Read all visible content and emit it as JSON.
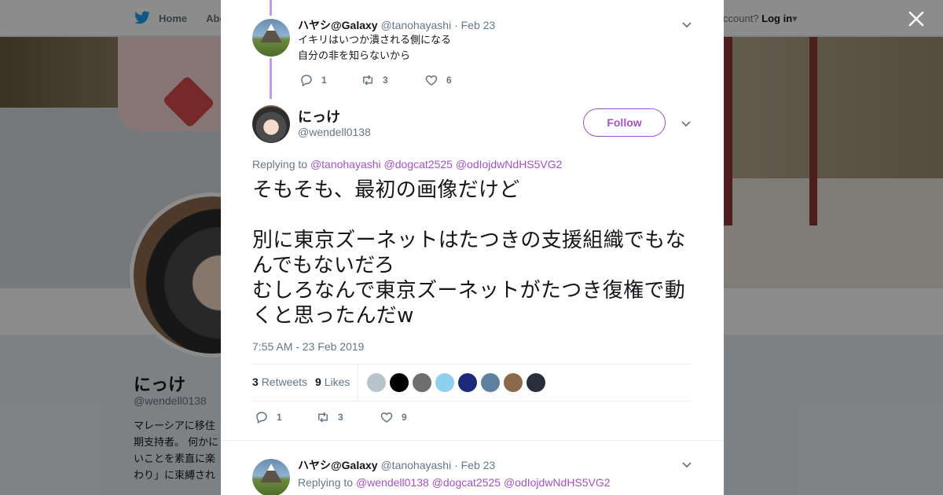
{
  "background": {
    "nav_home": "Home",
    "nav_about": "Abo",
    "account_prompt": "ccount?",
    "login_label": "Log in",
    "profile_name": "にっけ",
    "profile_handle": "@wendell0138",
    "bio": "マレーシアに移住\n期支持者。 何かに\nいことを素直に楽\nわり」に束縛され"
  },
  "colors": {
    "accent": "#a450c8",
    "thread": "#c897e8",
    "muted": "#657786",
    "text": "#14171a"
  },
  "prev_tweet": {
    "name": "ハヤシ@Galaxy",
    "handle": "@tanohayashi",
    "time": "· Feb 23",
    "text": "イキリはいつか潰される側になる\n自分の非を知らないから",
    "replies": "1",
    "retweets": "3",
    "likes": "6"
  },
  "main_tweet": {
    "name": "にっけ",
    "handle": "@wendell0138",
    "follow_label": "Follow",
    "replying_prefix": "Replying to",
    "mentions": [
      "@tanohayashi",
      "@dogcat2525",
      "@odIojdwNdHS5VG2"
    ],
    "text": "そもそも、最初の画像だけど\n\n別に東京ズーネットはたつきの支援組織でもなんでもないだろ\nむしろなんで東京ズーネットがたつき復権で動くと思ったんだw",
    "timestamp": "7:55 AM - 23 Feb 2019",
    "retweets_count": "3",
    "retweets_label": "Retweets",
    "likes_count": "9",
    "likes_label": "Likes",
    "liker_colors": [
      "#b8c4cc",
      "#000000",
      "#6e6e6e",
      "#8fd0f0",
      "#1b2a7a",
      "#5f7f9f",
      "#8a6a4a",
      "#2a2e3a"
    ],
    "replies": "1",
    "retweets": "3",
    "likes": "9"
  },
  "next_tweet": {
    "name": "ハヤシ@Galaxy",
    "handle": "@tanohayashi",
    "time": "· Feb 23",
    "replying_prefix": "Replying to",
    "mentions": [
      "@wendell0138",
      "@dogcat2525",
      "@odIojdwNdHS5VG2"
    ]
  }
}
